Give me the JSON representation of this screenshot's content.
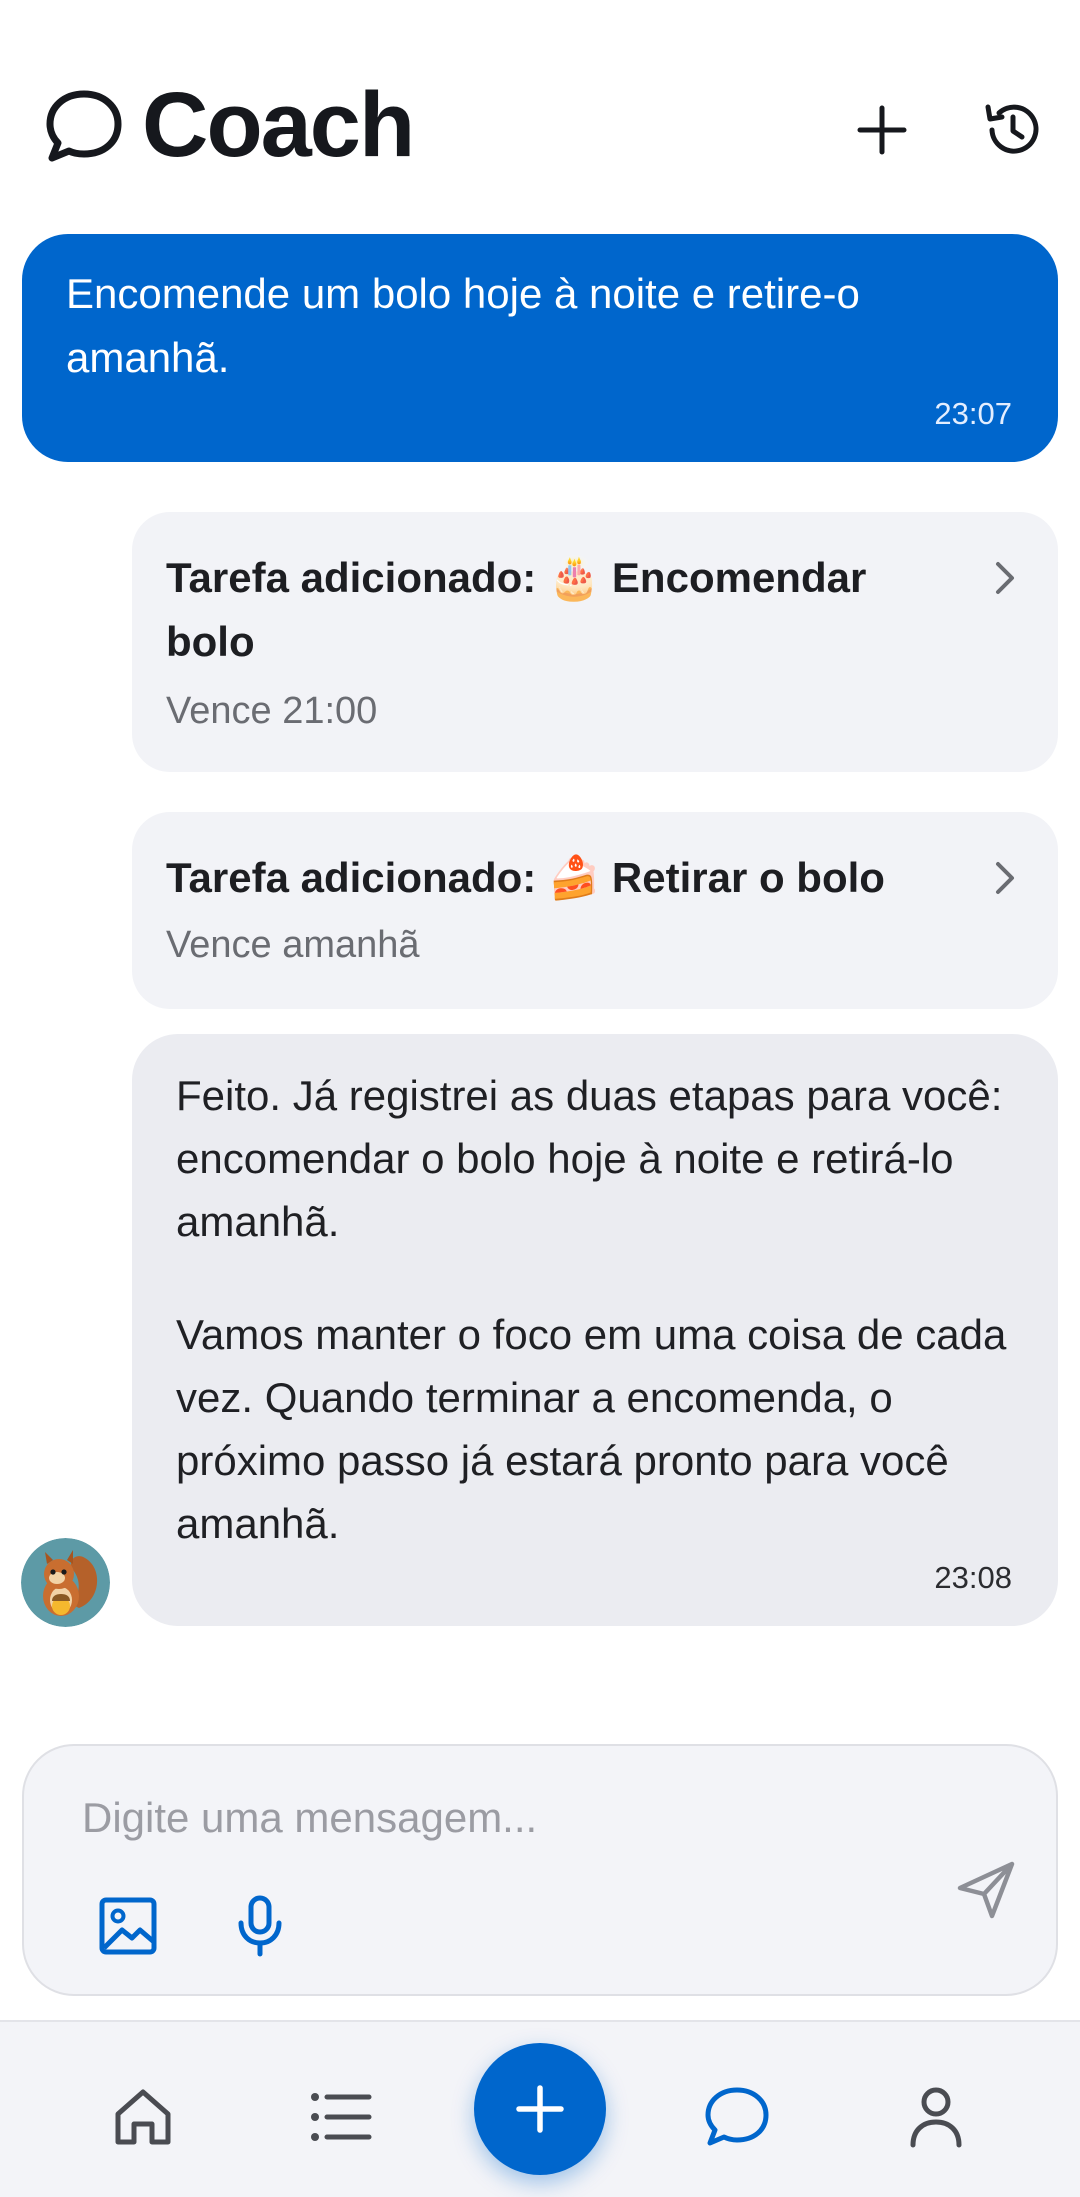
{
  "header": {
    "title": "Coach",
    "icons": {
      "brand": "chat-bubble-icon",
      "new": "plus-icon",
      "history": "history-icon"
    }
  },
  "colors": {
    "accent": "#0066cc",
    "card_bg": "#f2f3f7",
    "bot_bubble": "#ebecf1"
  },
  "messages": {
    "user": {
      "text": "Encomende um bolo hoje à noite e retire-o amanhã.",
      "time": "23:07"
    },
    "tasks": [
      {
        "title": "Tarefa adicionado: 🎂 Encomendar bolo",
        "due": "Vence 21:00"
      },
      {
        "title": "Tarefa adicionado: 🍰 Retirar o bolo",
        "due": "Vence amanhã"
      }
    ],
    "bot": {
      "paragraph1": "Feito. Já registrei as duas etapas para você: encomendar o bolo hoje à noite e retirá-lo amanhã.",
      "paragraph2": "Vamos manter o foco em uma coisa de cada vez. Quando terminar a encomenda, o próximo passo já estará pronto para você amanhã.",
      "time": "23:08",
      "avatar": "squirrel-avatar"
    }
  },
  "composer": {
    "placeholder": "Digite uma mensagem...",
    "value": "",
    "icons": {
      "image": "image-icon",
      "mic": "microphone-icon",
      "send": "send-icon"
    }
  },
  "nav": {
    "items": [
      "home-icon",
      "list-icon",
      "plus-icon",
      "chat-icon",
      "profile-icon"
    ],
    "active": "chat-icon"
  }
}
